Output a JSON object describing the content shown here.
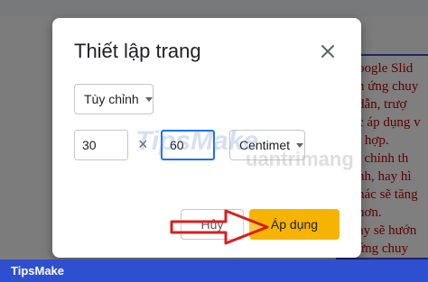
{
  "background": {
    "slide_lines": [
      "oogle Slid",
      "n ứng chuy",
      "dẫn, trượ",
      "c áp dụng v",
      "i hợp.",
      ", chỉnh th",
      "nh, hay hì",
      "hác sẽ tăng",
      "hơn.",
      "ày sẽ hướn",
      "ứng chuy"
    ]
  },
  "dialog": {
    "title": "Thiết lập trang",
    "preset": "Tùy chỉnh",
    "width_value": "30",
    "times_symbol": "×",
    "height_value": "60",
    "unit": "Centimet",
    "cancel_label": "Hủy",
    "apply_label": "Áp dụng"
  },
  "watermark": {
    "text": "TipsMake",
    "text2": "uantrimang"
  },
  "footer": {
    "brand": "TipsMake"
  },
  "colors": {
    "accent": "#f6b400",
    "focus": "#1a73e8",
    "footer": "#2f4fd1",
    "arrow": "#d62020"
  },
  "icons": {
    "close": "close-icon",
    "dropdown": "chevron-down-icon",
    "annotation": "arrow-icon"
  }
}
